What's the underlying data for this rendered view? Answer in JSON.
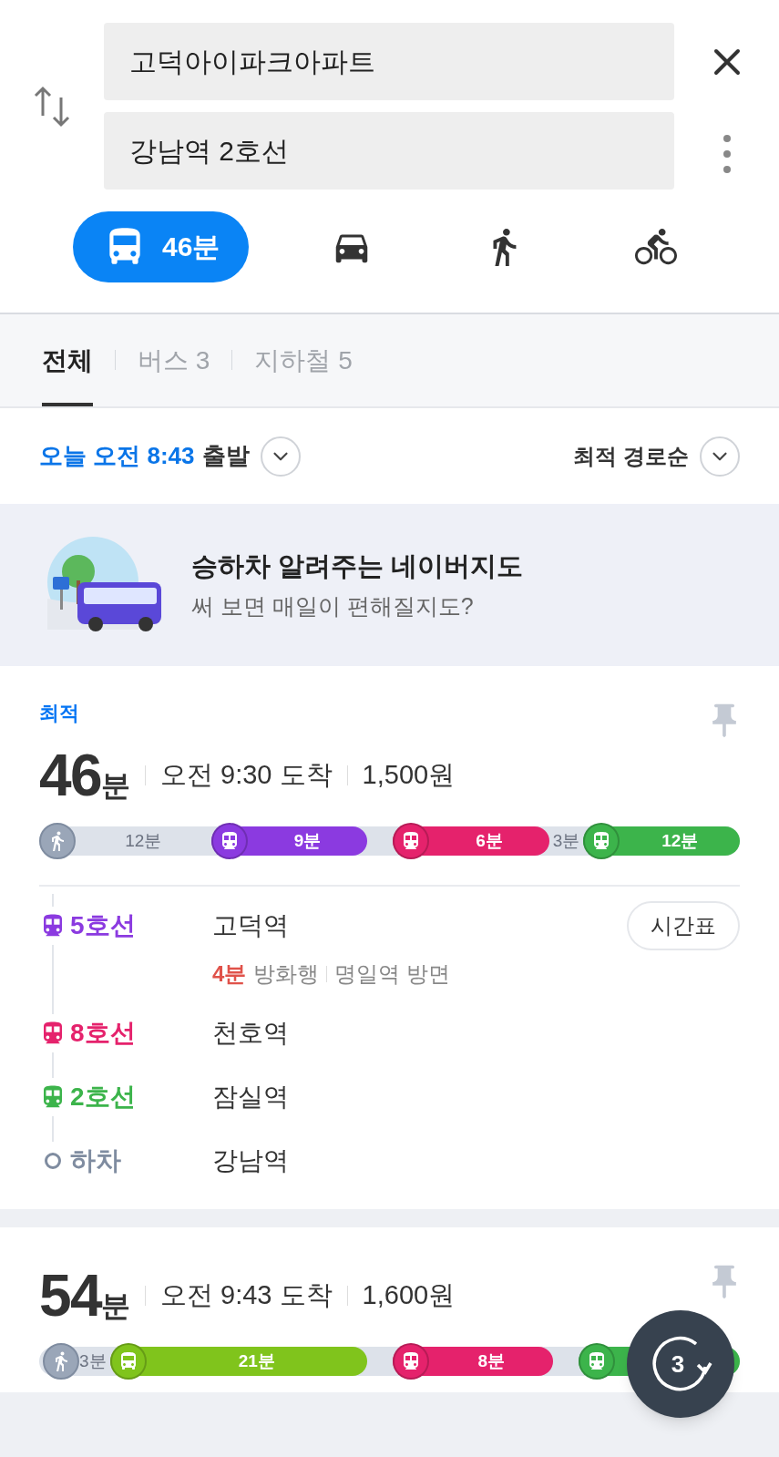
{
  "search": {
    "origin": "고덕아이파크아파트",
    "destination": "강남역 2호선"
  },
  "modes": [
    {
      "kind": "bus",
      "selected": true,
      "label": "46분"
    },
    {
      "kind": "car",
      "selected": false
    },
    {
      "kind": "walk",
      "selected": false
    },
    {
      "kind": "bike",
      "selected": false
    }
  ],
  "tabs": [
    {
      "label": "전체",
      "selected": true
    },
    {
      "label": "버스 3",
      "selected": false
    },
    {
      "label": "지하철 5",
      "selected": false
    }
  ],
  "departure": {
    "time": "오늘 오전 8:43",
    "suffix": "출발"
  },
  "sort": "최적 경로순",
  "banner": {
    "title": "승하차 알려주는 네이버지도",
    "subtitle": "써 보면 매일이 편해질지도?"
  },
  "routes": [
    {
      "badge": "최적",
      "minutes": "46",
      "unit": "분",
      "arrival": "오전 9:30 도착",
      "fare": "1,500원",
      "segments": [
        {
          "kind": "walk",
          "label": "12분"
        },
        {
          "kind": "subway",
          "color": "#8b3ae0",
          "label": "9분"
        },
        {
          "kind": "walk"
        },
        {
          "kind": "subway",
          "color": "#e5226c",
          "label": "6분"
        },
        {
          "kind": "walk",
          "label": "3분"
        },
        {
          "kind": "subway",
          "color": "#3cb44b",
          "label": "12분"
        }
      ],
      "steps": [
        {
          "kind": "subway",
          "line": "5호선",
          "color": "#8b3ae0",
          "station": "고덕역",
          "button": "시간표",
          "wait": "4분",
          "direction": "방화행",
          "heading": "명일역 방면"
        },
        {
          "kind": "subway",
          "line": "8호선",
          "color": "#e5226c",
          "station": "천호역"
        },
        {
          "kind": "subway",
          "line": "2호선",
          "color": "#3cb44b",
          "station": "잠실역"
        },
        {
          "kind": "alight",
          "line": "하차",
          "station": "강남역"
        }
      ]
    },
    {
      "minutes": "54",
      "unit": "분",
      "arrival": "오전 9:43 도착",
      "fare": "1,600원",
      "segments": [
        {
          "kind": "walk",
          "label": "3분"
        },
        {
          "kind": "bus",
          "color": "#80c41c",
          "label": "21분"
        },
        {
          "kind": "walk"
        },
        {
          "kind": "subway",
          "color": "#e5226c",
          "label": "8분"
        },
        {
          "kind": "walk"
        },
        {
          "kind": "subway",
          "color": "#3cb44b"
        }
      ]
    }
  ],
  "fab": {
    "count": "3"
  }
}
